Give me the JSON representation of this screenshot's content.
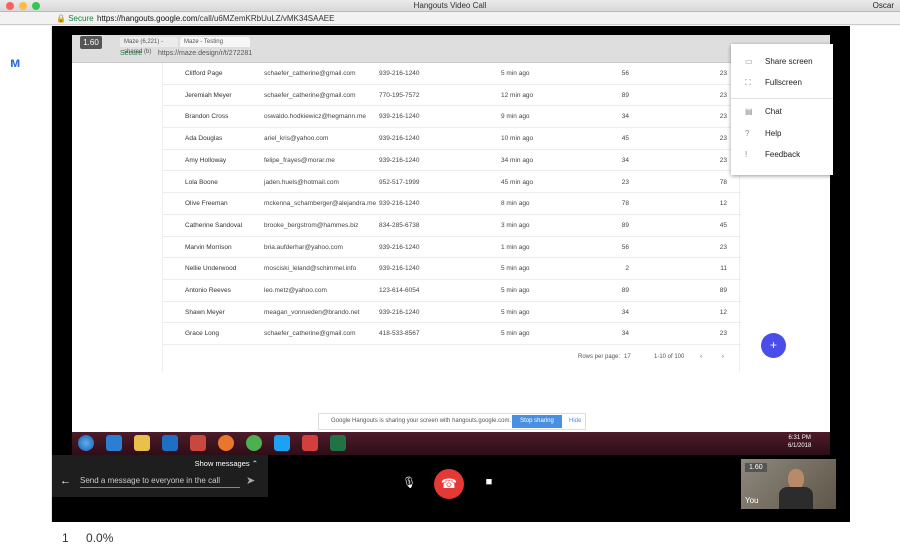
{
  "window": {
    "title": "Hangouts Video Call",
    "user": "Oscar"
  },
  "address": {
    "secure_label": "Secure",
    "url_prefix": "https://hangouts.google.com",
    "url_rest": "/call/u6MZemKRbUuLZ/vMK34SAAEE"
  },
  "shared_screen": {
    "zoom_badge": "1.60",
    "inner_tabs": [
      "Maze (6,221) - shared (b)",
      "Maze - Testing"
    ],
    "inner_secure_label": "Secure",
    "inner_url": "https://maze.design/r/t/272281",
    "rows": [
      {
        "name": "Clifford Page",
        "email": "schaefer_catherine@gmail.com",
        "phone": "939-216-1240",
        "time": "5 min ago",
        "n1": "56",
        "n2": "23"
      },
      {
        "name": "Jeremiah Meyer",
        "email": "schaefer_catherine@gmail.com",
        "phone": "770-195-7572",
        "time": "12 min ago",
        "n1": "89",
        "n2": "23"
      },
      {
        "name": "Brandon Cross",
        "email": "oswaldo.hodkiewicz@hegmann.me",
        "phone": "939-216-1240",
        "time": "9 min ago",
        "n1": "34",
        "n2": "23"
      },
      {
        "name": "Ada Douglas",
        "email": "ariel_kris@yahoo.com",
        "phone": "939-216-1240",
        "time": "10 min ago",
        "n1": "45",
        "n2": "23"
      },
      {
        "name": "Amy Holloway",
        "email": "felipe_frayes@morar.me",
        "phone": "939-216-1240",
        "time": "34 min ago",
        "n1": "34",
        "n2": "23"
      },
      {
        "name": "Lola Boone",
        "email": "jaden.huels@hotmail.com",
        "phone": "952-517-1999",
        "time": "45 min ago",
        "n1": "23",
        "n2": "78"
      },
      {
        "name": "Olive Freeman",
        "email": "mckenna_schamberger@alejandra.me",
        "phone": "939-216-1240",
        "time": "8 min ago",
        "n1": "78",
        "n2": "12"
      },
      {
        "name": "Catherine Sandoval",
        "email": "brooke_bergstrom@hammes.biz",
        "phone": "834-285-6738",
        "time": "3 min ago",
        "n1": "89",
        "n2": "45"
      },
      {
        "name": "Marvin Morrison",
        "email": "bria.aufderhar@yahoo.com",
        "phone": "939-216-1240",
        "time": "1 min ago",
        "n1": "56",
        "n2": "23"
      },
      {
        "name": "Nellie Underwood",
        "email": "mosciski_leland@schimmel.info",
        "phone": "939-216-1240",
        "time": "5 min ago",
        "n1": "2",
        "n2": "11"
      },
      {
        "name": "Antonio Reeves",
        "email": "leo.metz@yahoo.com",
        "phone": "123-614-6054",
        "time": "5 min ago",
        "n1": "89",
        "n2": "89"
      },
      {
        "name": "Shawn Meyer",
        "email": "meagan_vonrueden@brando.net",
        "phone": "939-216-1240",
        "time": "5 min ago",
        "n1": "34",
        "n2": "12"
      },
      {
        "name": "Grace Long",
        "email": "schaefer_catherine@gmail.com",
        "phone": "418-533-8567",
        "time": "5 min ago",
        "n1": "34",
        "n2": "23"
      }
    ],
    "pager": {
      "rows_label": "Rows per page:",
      "rows_value": "17",
      "range": "1-10 of 100"
    },
    "share_notice": {
      "message": "Google Hangouts is sharing your screen with hangouts.google.com.",
      "stop_label": "Stop sharing",
      "hide_label": "Hide"
    },
    "taskbar": {
      "time": "6:31 PM",
      "date": "6/1/2018"
    }
  },
  "menu": {
    "items": [
      {
        "label": "Share screen",
        "icon": "share-screen-icon"
      },
      {
        "label": "Fullscreen",
        "icon": "fullscreen-icon"
      },
      {
        "label": "Chat",
        "icon": "chat-icon"
      },
      {
        "label": "Help",
        "icon": "help-icon"
      },
      {
        "label": "Feedback",
        "icon": "feedback-icon"
      }
    ]
  },
  "chat": {
    "show_messages": "Show messages",
    "placeholder": "Send a message to everyone in the call"
  },
  "self_view": {
    "badge": "1.60",
    "label": "You"
  },
  "bottom": {
    "count": "1",
    "percent": "0.0%"
  }
}
